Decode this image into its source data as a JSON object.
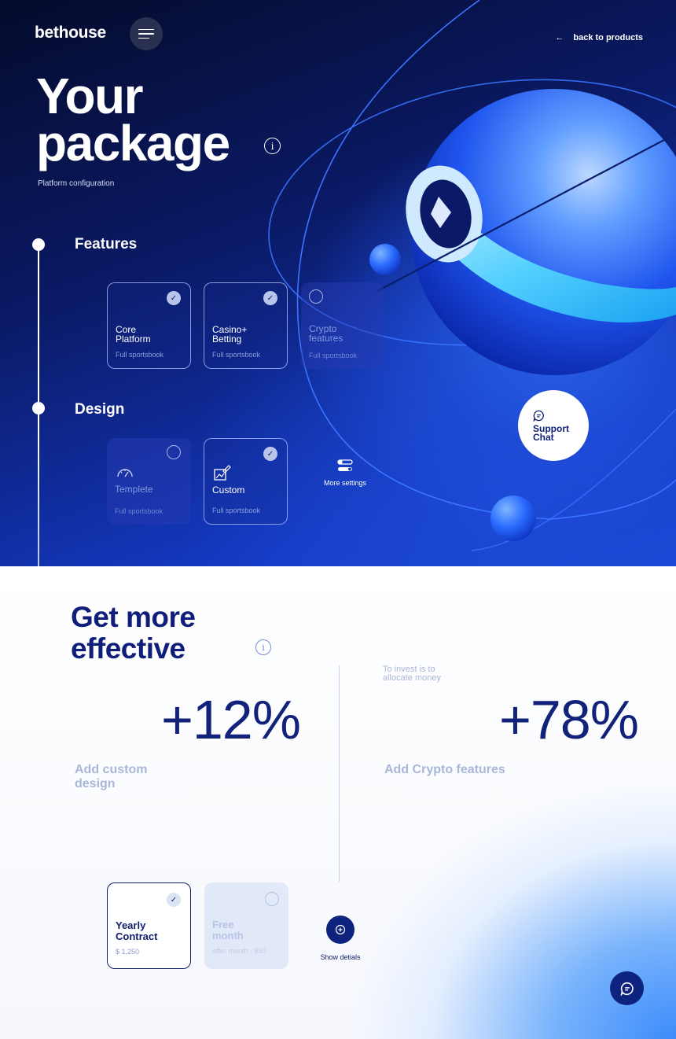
{
  "brand": {
    "logo": "bethouse"
  },
  "header": {
    "back_label": "back to products",
    "back_arrow": "←"
  },
  "hero": {
    "title_line1": "Your",
    "title_line2": "package",
    "subtitle": "Platform configuration",
    "info_glyph": "i"
  },
  "features": {
    "label": "Features",
    "cards": [
      {
        "title_line1": "Core",
        "title_line2": "Platform",
        "meta": "Full sportsbook",
        "selected": true
      },
      {
        "title_line1": "Casino+",
        "title_line2": "Betting",
        "meta": "Full sportsbook",
        "selected": true
      },
      {
        "title_line1": "Crypto",
        "title_line2": "features",
        "meta": "Full sportsbook",
        "selected": false
      }
    ]
  },
  "design": {
    "label": "Design",
    "cards": [
      {
        "title": "Templete",
        "meta": "Full sportsbook",
        "icon": "gauge-icon",
        "selected": false
      },
      {
        "title": "Custom",
        "meta": "Full sportsbook",
        "icon": "paint-brush-icon",
        "selected": true
      }
    ],
    "more_settings": "More settings"
  },
  "support": {
    "line1": "Support",
    "line2": "Chat"
  },
  "effective": {
    "title_line1": "Get more",
    "title_line2": "effective",
    "info_glyph": "i",
    "left": {
      "value": "+12%",
      "label": "Add custom design"
    },
    "right": {
      "value": "+78%",
      "label": "Add Crypto features",
      "note": "To invest is to allocate money"
    }
  },
  "pricing": {
    "cards": [
      {
        "title_line1": "Yearly",
        "title_line2": "Contract",
        "meta": "$ 1,250",
        "selected": true
      },
      {
        "title_line1": "Free",
        "title_line2": "month",
        "meta": "after month - $30",
        "selected": false
      }
    ],
    "show_details": "Show detials"
  },
  "check_glyph": "✓",
  "colors": {
    "navy": "#0e1e7a",
    "accent": "#1c4ad8",
    "muted": "#a8b7d9"
  }
}
